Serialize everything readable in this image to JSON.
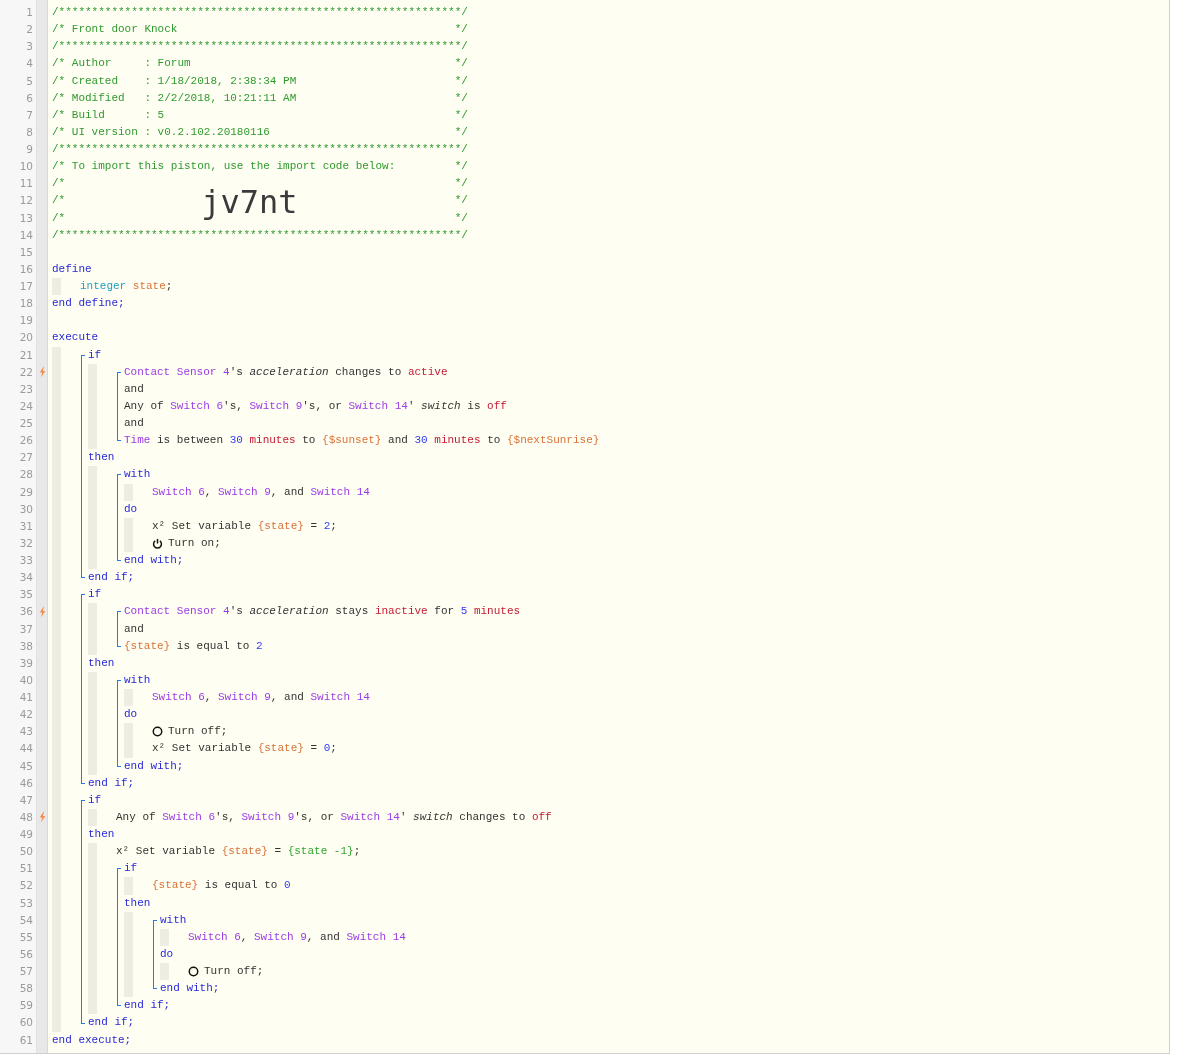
{
  "lines": [
    {
      "kind": "line",
      "number": "1",
      "trigger": false,
      "tokens": [
        {
          "kind": "comment",
          "text": "/*************************************************************/"
        }
      ]
    },
    {
      "kind": "line",
      "number": "2",
      "trigger": false,
      "tokens": [
        {
          "kind": "comment",
          "text": "/* Front door Knock"
        },
        {
          "kind": "end",
          "text": "*/"
        }
      ]
    },
    {
      "kind": "line",
      "number": "3",
      "trigger": false,
      "tokens": [
        {
          "kind": "comment",
          "text": "/*************************************************************/"
        }
      ]
    },
    {
      "kind": "line",
      "number": "4",
      "trigger": false,
      "tokens": [
        {
          "kind": "comment",
          "text": "/* Author     : Forum"
        },
        {
          "kind": "end",
          "text": "*/"
        }
      ]
    },
    {
      "kind": "line",
      "number": "5",
      "trigger": false,
      "tokens": [
        {
          "kind": "comment",
          "text": "/* Created    : 1/18/2018, 2:38:34 PM"
        },
        {
          "kind": "end",
          "text": "*/"
        }
      ]
    },
    {
      "kind": "line",
      "number": "6",
      "trigger": false,
      "tokens": [
        {
          "kind": "comment",
          "text": "/* Modified   : 2/2/2018, 10:21:11 AM"
        },
        {
          "kind": "end",
          "text": "*/"
        }
      ]
    },
    {
      "kind": "line",
      "number": "7",
      "trigger": false,
      "tokens": [
        {
          "kind": "comment",
          "text": "/* Build      : 5"
        },
        {
          "kind": "end",
          "text": "*/"
        }
      ]
    },
    {
      "kind": "line",
      "number": "8",
      "trigger": false,
      "tokens": [
        {
          "kind": "comment",
          "text": "/* UI version : v0.2.102.20180116"
        },
        {
          "kind": "end",
          "text": "*/"
        }
      ]
    },
    {
      "kind": "line",
      "number": "9",
      "trigger": false,
      "tokens": [
        {
          "kind": "comment",
          "text": "/*************************************************************/"
        }
      ]
    },
    {
      "kind": "line",
      "number": "10",
      "trigger": false,
      "tokens": [
        {
          "kind": "comment",
          "text": "/* To import this piston, use the import code below:"
        },
        {
          "kind": "end",
          "text": "*/"
        }
      ]
    },
    {
      "kind": "line",
      "number": "11",
      "trigger": false,
      "tokens": [
        {
          "kind": "comment",
          "text": "/*"
        },
        {
          "kind": "end",
          "text": "*/"
        }
      ]
    },
    {
      "kind": "line",
      "number": "12",
      "trigger": false,
      "tokens": [
        {
          "kind": "comment",
          "text": "/*"
        },
        {
          "kind": "code",
          "text": "jv7nt"
        },
        {
          "kind": "end",
          "text": "*/"
        }
      ]
    },
    {
      "kind": "line",
      "number": "13",
      "trigger": false,
      "tokens": [
        {
          "kind": "comment",
          "text": "/*"
        },
        {
          "kind": "end",
          "text": "*/"
        }
      ]
    },
    {
      "kind": "line",
      "number": "14",
      "trigger": false,
      "tokens": [
        {
          "kind": "comment",
          "text": "/*************************************************************/"
        }
      ]
    },
    {
      "kind": "line",
      "number": "15",
      "trigger": false
    },
    {
      "kind": "line",
      "number": "16",
      "trigger": false,
      "tokens": [
        {
          "kind": "keyword",
          "text": "define"
        }
      ],
      "children": [
        {
          "kind": "line",
          "number": "17",
          "trigger": false,
          "tokens": [
            {
              "kind": "type",
              "text": "integer "
            },
            {
              "kind": "var",
              "text": "state"
            },
            {
              "kind": "text",
              "text": ";"
            }
          ]
        }
      ]
    },
    {
      "kind": "line",
      "number": "18",
      "trigger": false,
      "tokens": [
        {
          "kind": "keyword",
          "text": "end define;"
        }
      ]
    },
    {
      "kind": "line",
      "number": "19",
      "trigger": false
    },
    {
      "kind": "line",
      "number": "20",
      "trigger": false,
      "tokens": [
        {
          "kind": "keyword",
          "text": "execute"
        }
      ],
      "children": [
        {
          "kind": "block",
          "lines": [
            {
              "kind": "line",
              "number": "21",
              "trigger": false,
              "tokens": [
                {
                  "kind": "keyword",
                  "text": "if"
                }
              ],
              "children": [
                {
                  "kind": "block",
                  "lines": [
                    {
                      "kind": "line",
                      "number": "22",
                      "trigger": true,
                      "tokens": [
                        {
                          "kind": "device",
                          "text": "Contact Sensor 4"
                        },
                        {
                          "kind": "text",
                          "text": "'s "
                        },
                        {
                          "kind": "attr",
                          "text": "acceleration"
                        },
                        {
                          "kind": "text",
                          "text": " changes to "
                        },
                        {
                          "kind": "value",
                          "text": "active"
                        }
                      ]
                    },
                    {
                      "kind": "line",
                      "number": "23",
                      "trigger": false,
                      "tokens": [
                        {
                          "kind": "text",
                          "text": "and"
                        }
                      ]
                    },
                    {
                      "kind": "line",
                      "number": "24",
                      "trigger": false,
                      "tokens": [
                        {
                          "kind": "text",
                          "text": "Any of "
                        },
                        {
                          "kind": "device",
                          "text": "Switch 6"
                        },
                        {
                          "kind": "text",
                          "text": "'s, "
                        },
                        {
                          "kind": "device",
                          "text": "Switch 9"
                        },
                        {
                          "kind": "text",
                          "text": "'s, or "
                        },
                        {
                          "kind": "device",
                          "text": "Switch 14"
                        },
                        {
                          "kind": "text",
                          "text": "' "
                        },
                        {
                          "kind": "attr",
                          "text": "switch"
                        },
                        {
                          "kind": "text",
                          "text": " is "
                        },
                        {
                          "kind": "value",
                          "text": "off"
                        }
                      ]
                    },
                    {
                      "kind": "line",
                      "number": "25",
                      "trigger": false,
                      "tokens": [
                        {
                          "kind": "text",
                          "text": "and"
                        }
                      ]
                    },
                    {
                      "kind": "line",
                      "number": "26",
                      "trigger": false,
                      "tokens": [
                        {
                          "kind": "device",
                          "text": "Time"
                        },
                        {
                          "kind": "text",
                          "text": " is between "
                        },
                        {
                          "kind": "number",
                          "text": "30 "
                        },
                        {
                          "kind": "value",
                          "text": "minutes"
                        },
                        {
                          "kind": "text",
                          "text": " to "
                        },
                        {
                          "kind": "var",
                          "text": "{$sunset}"
                        },
                        {
                          "kind": "text",
                          "text": " and "
                        },
                        {
                          "kind": "number",
                          "text": "30 "
                        },
                        {
                          "kind": "value",
                          "text": "minutes"
                        },
                        {
                          "kind": "text",
                          "text": " to "
                        },
                        {
                          "kind": "var",
                          "text": "{$nextSunrise}"
                        }
                      ]
                    }
                  ]
                }
              ]
            },
            {
              "kind": "line",
              "number": "27",
              "trigger": false,
              "tokens": [
                {
                  "kind": "keyword",
                  "text": "then"
                }
              ],
              "children": [
                {
                  "kind": "block",
                  "lines": [
                    {
                      "kind": "line",
                      "number": "28",
                      "trigger": false,
                      "tokens": [
                        {
                          "kind": "keyword",
                          "text": "with"
                        }
                      ],
                      "children": [
                        {
                          "kind": "line",
                          "number": "29",
                          "trigger": false,
                          "tokens": [
                            {
                              "kind": "device",
                              "text": "Switch 6"
                            },
                            {
                              "kind": "text",
                              "text": ", "
                            },
                            {
                              "kind": "device",
                              "text": "Switch 9"
                            },
                            {
                              "kind": "text",
                              "text": ", and "
                            },
                            {
                              "kind": "device",
                              "text": "Switch 14"
                            }
                          ]
                        }
                      ]
                    },
                    {
                      "kind": "line",
                      "number": "30",
                      "trigger": false,
                      "tokens": [
                        {
                          "kind": "keyword",
                          "text": "do"
                        }
                      ],
                      "children": [
                        {
                          "kind": "line",
                          "number": "31",
                          "trigger": false,
                          "tokens": [
                            {
                              "kind": "text",
                              "text": "x² Set variable "
                            },
                            {
                              "kind": "var",
                              "text": "{state}"
                            },
                            {
                              "kind": "text",
                              "text": " = "
                            },
                            {
                              "kind": "number",
                              "text": "2"
                            },
                            {
                              "kind": "text",
                              "text": ";"
                            }
                          ]
                        },
                        {
                          "kind": "line",
                          "number": "32",
                          "trigger": false,
                          "tokens": [
                            {
                              "kind": "power"
                            },
                            {
                              "kind": "text",
                              "text": "Turn on;"
                            }
                          ]
                        }
                      ]
                    },
                    {
                      "kind": "line",
                      "number": "33",
                      "trigger": false,
                      "tokens": [
                        {
                          "kind": "keyword",
                          "text": "end with;"
                        }
                      ]
                    }
                  ]
                }
              ]
            },
            {
              "kind": "line",
              "number": "34",
              "trigger": false,
              "tokens": [
                {
                  "kind": "keyword",
                  "text": "end if;"
                }
              ]
            }
          ]
        },
        {
          "kind": "block",
          "lines": [
            {
              "kind": "line",
              "number": "35",
              "trigger": false,
              "tokens": [
                {
                  "kind": "keyword",
                  "text": "if"
                }
              ],
              "children": [
                {
                  "kind": "block",
                  "lines": [
                    {
                      "kind": "line",
                      "number": "36",
                      "trigger": true,
                      "tokens": [
                        {
                          "kind": "device",
                          "text": "Contact Sensor 4"
                        },
                        {
                          "kind": "text",
                          "text": "'s "
                        },
                        {
                          "kind": "attr",
                          "text": "acceleration"
                        },
                        {
                          "kind": "text",
                          "text": " stays "
                        },
                        {
                          "kind": "value",
                          "text": "inactive"
                        },
                        {
                          "kind": "text",
                          "text": " for "
                        },
                        {
                          "kind": "number",
                          "text": "5 "
                        },
                        {
                          "kind": "value",
                          "text": "minutes"
                        }
                      ]
                    },
                    {
                      "kind": "line",
                      "number": "37",
                      "trigger": false,
                      "tokens": [
                        {
                          "kind": "text",
                          "text": "and"
                        }
                      ]
                    },
                    {
                      "kind": "line",
                      "number": "38",
                      "trigger": false,
                      "tokens": [
                        {
                          "kind": "var",
                          "text": "{state}"
                        },
                        {
                          "kind": "text",
                          "text": " is equal to "
                        },
                        {
                          "kind": "number",
                          "text": "2"
                        }
                      ]
                    }
                  ]
                }
              ]
            },
            {
              "kind": "line",
              "number": "39",
              "trigger": false,
              "tokens": [
                {
                  "kind": "keyword",
                  "text": "then"
                }
              ],
              "children": [
                {
                  "kind": "block",
                  "lines": [
                    {
                      "kind": "line",
                      "number": "40",
                      "trigger": false,
                      "tokens": [
                        {
                          "kind": "keyword",
                          "text": "with"
                        }
                      ],
                      "children": [
                        {
                          "kind": "line",
                          "number": "41",
                          "trigger": false,
                          "tokens": [
                            {
                              "kind": "device",
                              "text": "Switch 6"
                            },
                            {
                              "kind": "text",
                              "text": ", "
                            },
                            {
                              "kind": "device",
                              "text": "Switch 9"
                            },
                            {
                              "kind": "text",
                              "text": ", and "
                            },
                            {
                              "kind": "device",
                              "text": "Switch 14"
                            }
                          ]
                        }
                      ]
                    },
                    {
                      "kind": "line",
                      "number": "42",
                      "trigger": false,
                      "tokens": [
                        {
                          "kind": "keyword",
                          "text": "do"
                        }
                      ],
                      "children": [
                        {
                          "kind": "line",
                          "number": "43",
                          "trigger": false,
                          "tokens": [
                            {
                              "kind": "ring"
                            },
                            {
                              "kind": "text",
                              "text": "Turn off;"
                            }
                          ]
                        },
                        {
                          "kind": "line",
                          "number": "44",
                          "trigger": false,
                          "tokens": [
                            {
                              "kind": "text",
                              "text": "x² Set variable "
                            },
                            {
                              "kind": "var",
                              "text": "{state}"
                            },
                            {
                              "kind": "text",
                              "text": " = "
                            },
                            {
                              "kind": "number",
                              "text": "0"
                            },
                            {
                              "kind": "text",
                              "text": ";"
                            }
                          ]
                        }
                      ]
                    },
                    {
                      "kind": "line",
                      "number": "45",
                      "trigger": false,
                      "tokens": [
                        {
                          "kind": "keyword",
                          "text": "end with;"
                        }
                      ]
                    }
                  ]
                }
              ]
            },
            {
              "kind": "line",
              "number": "46",
              "trigger": false,
              "tokens": [
                {
                  "kind": "keyword",
                  "text": "end if;"
                }
              ]
            }
          ]
        },
        {
          "kind": "block",
          "lines": [
            {
              "kind": "line",
              "number": "47",
              "trigger": false,
              "tokens": [
                {
                  "kind": "keyword",
                  "text": "if"
                }
              ],
              "children": [
                {
                  "kind": "line",
                  "number": "48",
                  "trigger": true,
                  "tokens": [
                    {
                      "kind": "text",
                      "text": "Any of "
                    },
                    {
                      "kind": "device",
                      "text": "Switch 6"
                    },
                    {
                      "kind": "text",
                      "text": "'s, "
                    },
                    {
                      "kind": "device",
                      "text": "Switch 9"
                    },
                    {
                      "kind": "text",
                      "text": "'s, or "
                    },
                    {
                      "kind": "device",
                      "text": "Switch 14"
                    },
                    {
                      "kind": "text",
                      "text": "' "
                    },
                    {
                      "kind": "attr",
                      "text": "switch"
                    },
                    {
                      "kind": "text",
                      "text": " changes to "
                    },
                    {
                      "kind": "value",
                      "text": "off"
                    }
                  ]
                }
              ]
            },
            {
              "kind": "line",
              "number": "49",
              "trigger": false,
              "tokens": [
                {
                  "kind": "keyword",
                  "text": "then"
                }
              ],
              "children": [
                {
                  "kind": "line",
                  "number": "50",
                  "trigger": false,
                  "tokens": [
                    {
                      "kind": "text",
                      "text": "x² Set variable "
                    },
                    {
                      "kind": "var",
                      "text": "{state}"
                    },
                    {
                      "kind": "text",
                      "text": " = "
                    },
                    {
                      "kind": "expr",
                      "text": "{state -1}"
                    },
                    {
                      "kind": "text",
                      "text": ";"
                    }
                  ]
                },
                {
                  "kind": "block",
                  "lines": [
                    {
                      "kind": "line",
                      "number": "51",
                      "trigger": false,
                      "tokens": [
                        {
                          "kind": "keyword",
                          "text": "if"
                        }
                      ],
                      "children": [
                        {
                          "kind": "line",
                          "number": "52",
                          "trigger": false,
                          "tokens": [
                            {
                              "kind": "var",
                              "text": "{state}"
                            },
                            {
                              "kind": "text",
                              "text": " is equal to "
                            },
                            {
                              "kind": "number",
                              "text": "0"
                            }
                          ]
                        }
                      ]
                    },
                    {
                      "kind": "line",
                      "number": "53",
                      "trigger": false,
                      "tokens": [
                        {
                          "kind": "keyword",
                          "text": "then"
                        }
                      ],
                      "children": [
                        {
                          "kind": "block",
                          "lines": [
                            {
                              "kind": "line",
                              "number": "54",
                              "trigger": false,
                              "tokens": [
                                {
                                  "kind": "keyword",
                                  "text": "with"
                                }
                              ],
                              "children": [
                                {
                                  "kind": "line",
                                  "number": "55",
                                  "trigger": false,
                                  "tokens": [
                                    {
                                      "kind": "device",
                                      "text": "Switch 6"
                                    },
                                    {
                                      "kind": "text",
                                      "text": ", "
                                    },
                                    {
                                      "kind": "device",
                                      "text": "Switch 9"
                                    },
                                    {
                                      "kind": "text",
                                      "text": ", and "
                                    },
                                    {
                                      "kind": "device",
                                      "text": "Switch 14"
                                    }
                                  ]
                                }
                              ]
                            },
                            {
                              "kind": "line",
                              "number": "56",
                              "trigger": false,
                              "tokens": [
                                {
                                  "kind": "keyword",
                                  "text": "do"
                                }
                              ],
                              "children": [
                                {
                                  "kind": "line",
                                  "number": "57",
                                  "trigger": false,
                                  "tokens": [
                                    {
                                      "kind": "ring"
                                    },
                                    {
                                      "kind": "text",
                                      "text": "Turn off;"
                                    }
                                  ]
                                }
                              ]
                            },
                            {
                              "kind": "line",
                              "number": "58",
                              "trigger": false,
                              "tokens": [
                                {
                                  "kind": "keyword",
                                  "text": "end with;"
                                }
                              ]
                            }
                          ]
                        }
                      ]
                    },
                    {
                      "kind": "line",
                      "number": "59",
                      "trigger": false,
                      "tokens": [
                        {
                          "kind": "keyword",
                          "text": "end if;"
                        }
                      ]
                    }
                  ]
                }
              ]
            },
            {
              "kind": "line",
              "number": "60",
              "trigger": false,
              "tokens": [
                {
                  "kind": "keyword",
                  "text": "end if;"
                }
              ]
            }
          ]
        }
      ]
    },
    {
      "kind": "line",
      "number": "61",
      "trigger": false,
      "tokens": [
        {
          "kind": "keyword",
          "text": "end execute;"
        }
      ]
    }
  ]
}
